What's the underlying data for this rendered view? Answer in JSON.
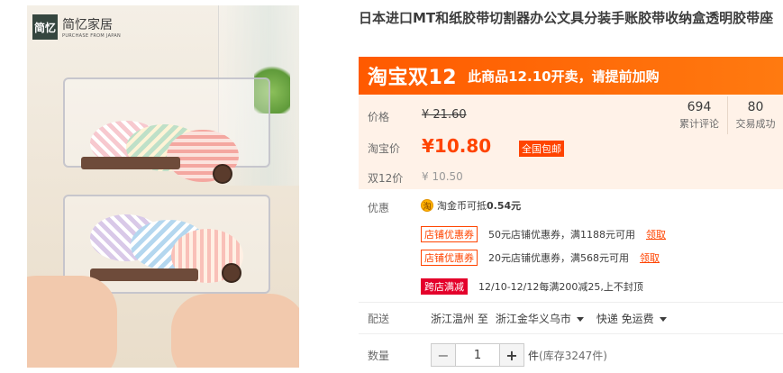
{
  "image": {
    "logo_mark": "简忆",
    "brand_cn": "简忆家居",
    "brand_en": "PURCHASE FROM JAPAN"
  },
  "product": {
    "title": "日本进口MT和纸胶带切割器办公文具分装手账胶带收纳盒透明胶带座"
  },
  "promo": {
    "logo": "淘宝双12",
    "text": "此商品12.10开卖，请提前加购"
  },
  "price": {
    "original_label": "价格",
    "original_value": "¥ 21.60",
    "taobao_label": "淘宝价",
    "taobao_value": "¥10.80",
    "free_ship_badge": "全国包邮",
    "d12_label": "双12价",
    "d12_value": "¥ 10.50"
  },
  "stats": [
    {
      "num": "694",
      "label": "累计评论"
    },
    {
      "num": "80",
      "label": "交易成功"
    }
  ],
  "discount": {
    "label": "优惠",
    "coin_icon": "淘",
    "coin_text": "淘金币可抵",
    "coin_amount": "0.54元",
    "coupons": [
      {
        "tag": "店铺优惠券",
        "text": "50元店铺优惠券，满1188元可用",
        "link": "领取"
      },
      {
        "tag": "店铺优惠券",
        "text": "20元店铺优惠券，满568元可用",
        "link": "领取"
      }
    ],
    "cross_store_tag": "跨店满减",
    "cross_store_text": "12/10-12/12每满200减25,上不封顶"
  },
  "shipping": {
    "label": "配送",
    "from": "浙江温州 至",
    "to": "浙江金华义乌市",
    "method": "快递 免运费"
  },
  "quantity": {
    "label": "数量",
    "minus": "−",
    "value": "1",
    "plus": "+",
    "unit": "件",
    "stock": "(库存3247件)"
  },
  "colors": {
    "accent": "#ff4400",
    "promo_bg": "#ff5a00",
    "price_bg": "#fff2e8"
  }
}
